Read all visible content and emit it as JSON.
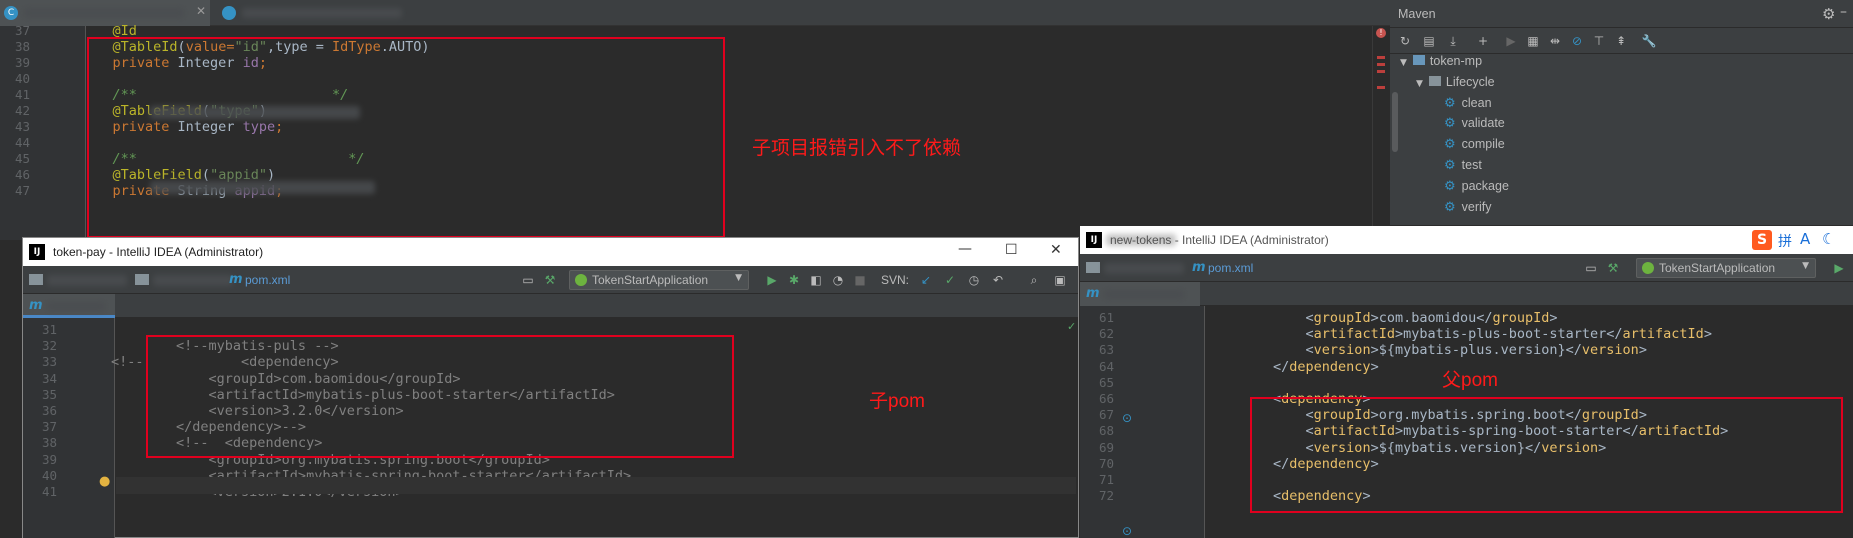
{
  "top_editor": {
    "tabs": [
      {
        "label": "▒▒▒▒▒▒▒▒▒▒▒"
      },
      {
        "label": "▒▒▒▒▒▒▒▒▒▒▒▒▒"
      }
    ],
    "lines": [
      {
        "num": "37",
        "parts": [
          {
            "t": "    @Id",
            "c": "ann"
          }
        ]
      },
      {
        "num": "38",
        "parts": [
          {
            "t": "    @TableId",
            "c": "ann"
          },
          {
            "t": "(",
            "c": "plain"
          },
          {
            "t": "value=",
            "c": "redtype"
          },
          {
            "t": "\"id\"",
            "c": "str"
          },
          {
            "t": ",type = ",
            "c": "plain"
          },
          {
            "t": "IdType",
            "c": "redtype"
          },
          {
            "t": ".AUTO)",
            "c": "plain"
          }
        ]
      },
      {
        "num": "39",
        "parts": [
          {
            "t": "    private ",
            "c": "kw"
          },
          {
            "t": "Integer ",
            "c": "plain"
          },
          {
            "t": "id",
            "c": "field"
          },
          {
            "t": ";",
            "c": "kw"
          }
        ]
      },
      {
        "num": "40",
        "parts": []
      },
      {
        "num": "41",
        "parts": [
          {
            "t": "    /**",
            "c": "cmt"
          },
          {
            "t": "                        */",
            "c": "cmt"
          }
        ]
      },
      {
        "num": "42",
        "parts": [
          {
            "t": "    @TableField",
            "c": "ann"
          },
          {
            "t": "(",
            "c": "plain"
          },
          {
            "t": "\"type\"",
            "c": "str"
          },
          {
            "t": ")",
            "c": "plain"
          }
        ]
      },
      {
        "num": "43",
        "parts": [
          {
            "t": "    private ",
            "c": "kw"
          },
          {
            "t": "Integer ",
            "c": "plain"
          },
          {
            "t": "type",
            "c": "field"
          },
          {
            "t": ";",
            "c": "kw"
          }
        ]
      },
      {
        "num": "44",
        "parts": []
      },
      {
        "num": "45",
        "parts": [
          {
            "t": "    /**",
            "c": "cmt"
          },
          {
            "t": "                          */",
            "c": "cmt"
          }
        ]
      },
      {
        "num": "46",
        "parts": [
          {
            "t": "    @TableField",
            "c": "ann"
          },
          {
            "t": "(",
            "c": "plain"
          },
          {
            "t": "\"appid\"",
            "c": "str"
          },
          {
            "t": ")",
            "c": "plain"
          }
        ]
      },
      {
        "num": "47",
        "parts": [
          {
            "t": "    private ",
            "c": "kw"
          },
          {
            "t": "String ",
            "c": "plain"
          },
          {
            "t": "appid",
            "c": "field"
          },
          {
            "t": ";",
            "c": "kw"
          }
        ]
      }
    ],
    "annotation": "子项目报错引入不了依赖"
  },
  "maven": {
    "title": "Maven",
    "tree": [
      {
        "label": "token-mp",
        "level": 0,
        "kind": "module"
      },
      {
        "label": "Lifecycle",
        "level": 1,
        "kind": "folder"
      },
      {
        "label": "clean",
        "level": 2,
        "kind": "goal"
      },
      {
        "label": "validate",
        "level": 2,
        "kind": "goal"
      },
      {
        "label": "compile",
        "level": 2,
        "kind": "goal"
      },
      {
        "label": "test",
        "level": 2,
        "kind": "goal"
      },
      {
        "label": "package",
        "level": 2,
        "kind": "goal"
      },
      {
        "label": "verify",
        "level": 2,
        "kind": "goal"
      }
    ]
  },
  "left_window": {
    "title": "token-pay - IntelliJ IDEA (Administrator)",
    "breadcrumb_file": "pom.xml",
    "run_config": "TokenStartApplication",
    "svn_label": "SVN:",
    "annotation": "子pom",
    "lines": [
      {
        "num": "31",
        "parts": []
      },
      {
        "num": "32",
        "parts": [
          {
            "t": "        <!--mybatis-puls -->",
            "c": "gray"
          }
        ]
      },
      {
        "num": "33",
        "parts": [
          {
            "t": "<!--  ",
            "c": "gray"
          },
          {
            "t": "          <dependency>",
            "c": "gray"
          }
        ]
      },
      {
        "num": "34",
        "parts": [
          {
            "t": "            <groupId>com.baomidou</groupId>",
            "c": "gray"
          }
        ]
      },
      {
        "num": "35",
        "parts": [
          {
            "t": "            <artifactId>mybatis-plus-boot-starter</artifactId>",
            "c": "gray"
          }
        ]
      },
      {
        "num": "36",
        "parts": [
          {
            "t": "            <version>3.2.0</version>",
            "c": "gray"
          }
        ]
      },
      {
        "num": "37",
        "parts": [
          {
            "t": "        </dependency>-->",
            "c": "gray"
          }
        ]
      },
      {
        "num": "38",
        "parts": [
          {
            "t": "        <!-- ",
            "c": "gray"
          },
          {
            "t": " <dependency>",
            "c": "gray"
          }
        ]
      },
      {
        "num": "39",
        "parts": [
          {
            "t": "            <groupId>org.mybatis.spring.boot</groupId>",
            "c": "gray"
          }
        ]
      },
      {
        "num": "40",
        "parts": [
          {
            "t": "            <artifactId>mybatis-spring-boot-starter</artifactId>",
            "c": "gray"
          }
        ]
      },
      {
        "num": "41",
        "parts": [
          {
            "t": "            <version>2.1.0</version>",
            "c": "gray"
          }
        ]
      }
    ]
  },
  "right_window": {
    "title": "new-tokens - IntelliJ IDEA (Administrator)",
    "breadcrumb_file": "pom.xml",
    "run_config": "TokenStartApplication",
    "annotation": "父pom",
    "ime_icons": [
      "S",
      "拼",
      "A",
      "☾"
    ],
    "lines": [
      {
        "num": "61",
        "parts": [
          {
            "t": "            <",
            "c": "plain"
          },
          {
            "t": "groupId",
            "c": "tag"
          },
          {
            "t": ">com.baomidou</",
            "c": "plain"
          },
          {
            "t": "groupId",
            "c": "tag"
          },
          {
            "t": ">",
            "c": "plain"
          }
        ]
      },
      {
        "num": "62",
        "parts": [
          {
            "t": "            <",
            "c": "plain"
          },
          {
            "t": "artifactId",
            "c": "tag"
          },
          {
            "t": ">mybatis-plus-boot-starter</",
            "c": "plain"
          },
          {
            "t": "artifactId",
            "c": "tag"
          },
          {
            "t": ">",
            "c": "plain"
          }
        ]
      },
      {
        "num": "63",
        "parts": [
          {
            "t": "            <",
            "c": "plain"
          },
          {
            "t": "version",
            "c": "tag"
          },
          {
            "t": ">${mybatis-plus.version}</",
            "c": "plain"
          },
          {
            "t": "version",
            "c": "tag"
          },
          {
            "t": ">",
            "c": "plain"
          }
        ]
      },
      {
        "num": "64",
        "parts": [
          {
            "t": "        </",
            "c": "plain"
          },
          {
            "t": "dependency",
            "c": "tag"
          },
          {
            "t": ">",
            "c": "plain"
          }
        ]
      },
      {
        "num": "65",
        "parts": []
      },
      {
        "num": "66",
        "parts": [
          {
            "t": "        <",
            "c": "plain"
          },
          {
            "t": "dependency",
            "c": "tag"
          },
          {
            "t": ">",
            "c": "plain"
          }
        ]
      },
      {
        "num": "67",
        "parts": [
          {
            "t": "            <",
            "c": "plain"
          },
          {
            "t": "groupId",
            "c": "tag"
          },
          {
            "t": ">org.mybatis.spring.boot</",
            "c": "plain"
          },
          {
            "t": "groupId",
            "c": "tag"
          },
          {
            "t": ">",
            "c": "plain"
          }
        ]
      },
      {
        "num": "68",
        "parts": [
          {
            "t": "            <",
            "c": "plain"
          },
          {
            "t": "artifactId",
            "c": "tag"
          },
          {
            "t": ">mybatis-spring-boot-starter</",
            "c": "plain"
          },
          {
            "t": "artifactId",
            "c": "tag"
          },
          {
            "t": ">",
            "c": "plain"
          }
        ]
      },
      {
        "num": "69",
        "parts": [
          {
            "t": "            <",
            "c": "plain"
          },
          {
            "t": "version",
            "c": "tag"
          },
          {
            "t": ">${mybatis.version}</",
            "c": "plain"
          },
          {
            "t": "version",
            "c": "tag"
          },
          {
            "t": ">",
            "c": "plain"
          }
        ]
      },
      {
        "num": "70",
        "parts": [
          {
            "t": "        </",
            "c": "plain"
          },
          {
            "t": "dependency",
            "c": "tag"
          },
          {
            "t": ">",
            "c": "plain"
          }
        ]
      },
      {
        "num": "71",
        "parts": []
      },
      {
        "num": "72",
        "parts": [
          {
            "t": "        <",
            "c": "plain"
          },
          {
            "t": "dependency",
            "c": "tag"
          },
          {
            "t": ">",
            "c": "plain"
          }
        ]
      }
    ]
  }
}
